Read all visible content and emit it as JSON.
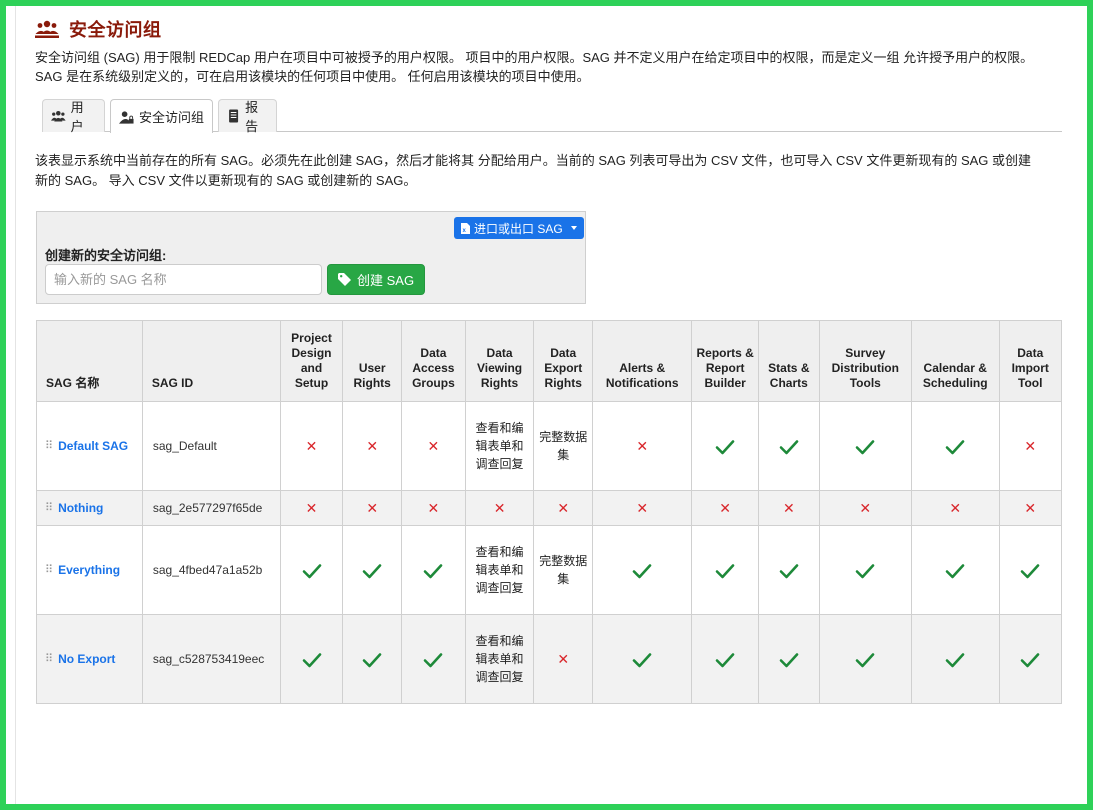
{
  "header": {
    "title": "安全访问组",
    "intro": "安全访问组 (SAG) 用于限制 REDCap 用户在项目中可被授予的用户权限。 项目中的用户权限。SAG 并不定义用户在给定项目中的权限，而是定义一组 允许授予用户的权限。SAG 是在系统级别定义的，可在启用该模块的任何项目中使用。 任何启用该模块的项目中使用。"
  },
  "tabs": [
    {
      "label": "用户",
      "icon": "users-icon",
      "active": false
    },
    {
      "label": "安全访问组",
      "icon": "user-lock-icon",
      "active": true
    },
    {
      "label": "报告",
      "icon": "report-icon",
      "active": false
    }
  ],
  "description": "该表显示系统中当前存在的所有 SAG。必须先在此创建 SAG，然后才能将其 分配给用户。当前的 SAG 列表可导出为 CSV 文件，也可导入 CSV 文件更新现有的 SAG 或创建新的 SAG。 导入 CSV 文件以更新现有的 SAG 或创建新的 SAG。",
  "create": {
    "import_export_label": "进口或出口 SAG",
    "label": "创建新的安全访问组:",
    "placeholder": "输入新的 SAG 名称",
    "button_label": "创建 SAG"
  },
  "colors": {
    "title": "#8a1a0a",
    "link": "#1a73e8",
    "check": "#1e8a3a",
    "cross": "#d9262b",
    "create_button": "#28a745",
    "frame_border": "#2ed158"
  },
  "table": {
    "columns": [
      {
        "key": "name",
        "label": "SAG 名称"
      },
      {
        "key": "id",
        "label": "SAG ID"
      },
      {
        "key": "design",
        "label": "Project Design and Setup"
      },
      {
        "key": "user_rights",
        "label": "User Rights"
      },
      {
        "key": "dag",
        "label": "Data Access Groups"
      },
      {
        "key": "viewing",
        "label": "Data Viewing Rights"
      },
      {
        "key": "export",
        "label": "Data Export Rights"
      },
      {
        "key": "alerts",
        "label": "Alerts & Notifications"
      },
      {
        "key": "reports",
        "label": "Reports & Report Builder"
      },
      {
        "key": "stats",
        "label": "Stats & Charts"
      },
      {
        "key": "survey",
        "label": "Survey Distribution Tools"
      },
      {
        "key": "calendar",
        "label": "Calendar & Scheduling"
      },
      {
        "key": "import",
        "label": "Data Import Tool"
      }
    ],
    "rows": [
      {
        "name": "Default SAG",
        "id": "sag_Default",
        "cells": [
          "x",
          "x",
          "x",
          "查看和编辑表单和调查回复",
          "完整数据集",
          "x",
          "check",
          "check",
          "check",
          "check",
          "x"
        ]
      },
      {
        "name": "Nothing",
        "id": "sag_2e577297f65de",
        "cells": [
          "x",
          "x",
          "x",
          "x",
          "x",
          "x",
          "x",
          "x",
          "x",
          "x",
          "x"
        ]
      },
      {
        "name": "Everything",
        "id": "sag_4fbed47a1a52b",
        "cells": [
          "check",
          "check",
          "check",
          "查看和编辑表单和调查回复",
          "完整数据集",
          "check",
          "check",
          "check",
          "check",
          "check",
          "check"
        ]
      },
      {
        "name": "No Export",
        "id": "sag_c528753419eec",
        "cells": [
          "check",
          "check",
          "check",
          "查看和编辑表单和调查回复",
          "x",
          "check",
          "check",
          "check",
          "check",
          "check",
          "check"
        ]
      }
    ]
  }
}
